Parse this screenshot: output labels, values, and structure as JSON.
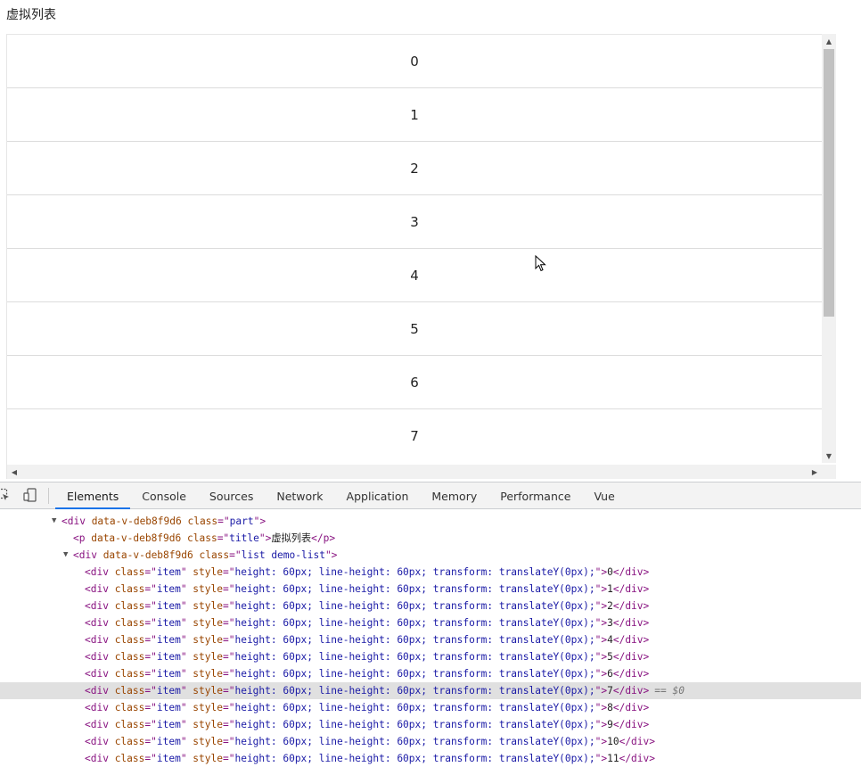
{
  "title": "虚拟列表",
  "list_items": [
    "0",
    "1",
    "2",
    "3",
    "4",
    "5",
    "6",
    "7"
  ],
  "devtools": {
    "tabs": [
      "Elements",
      "Console",
      "Sources",
      "Network",
      "Application",
      "Memory",
      "Performance",
      "Vue"
    ],
    "active_tab": "Elements",
    "dom": {
      "part_id": "data-v-deb8f9d6",
      "part_class": "part",
      "title_class": "title",
      "title_text": "虚拟列表",
      "list_class": "list demo-list",
      "item_class": "item",
      "item_style": "height: 60px; line-height: 60px; transform: translateY(0px);",
      "items": [
        "0",
        "1",
        "2",
        "3",
        "4",
        "5",
        "6",
        "7",
        "8",
        "9",
        "10",
        "11"
      ],
      "selected_index": 7,
      "selected_marker": "== $0"
    }
  }
}
